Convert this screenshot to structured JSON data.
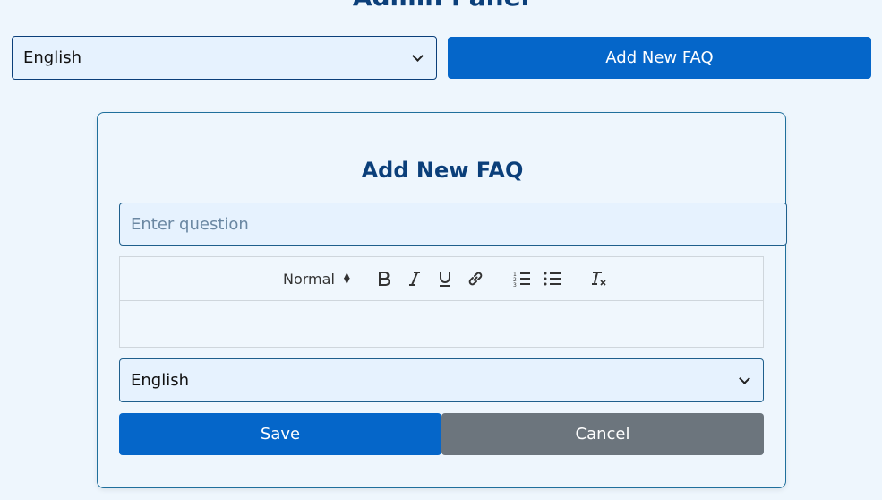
{
  "header": {
    "title": "Admin Panel"
  },
  "top_bar": {
    "language_select_value": "English",
    "add_button_label": "Add New FAQ"
  },
  "form": {
    "title": "Add New FAQ",
    "question_placeholder": "Enter question",
    "editor": {
      "header_format": "Normal",
      "tools": [
        "bold-icon",
        "italic-icon",
        "underline-icon",
        "link-icon",
        "ordered-list-icon",
        "bullet-list-icon",
        "clear-format-icon"
      ]
    },
    "language_select_value": "English",
    "save_label": "Save",
    "cancel_label": "Cancel"
  },
  "colors": {
    "primary": "#0566c9",
    "secondary": "#6c757d",
    "heading": "#0b3f7a",
    "background": "#eef6fd"
  }
}
